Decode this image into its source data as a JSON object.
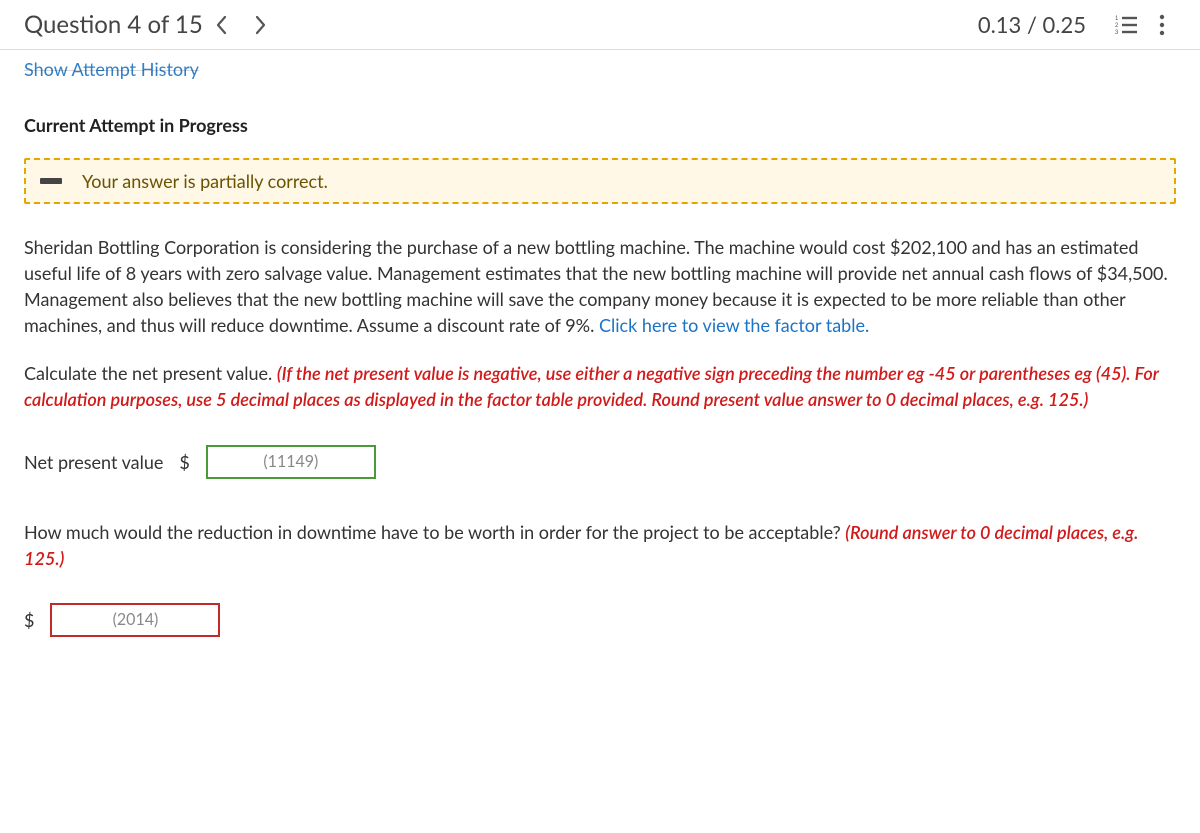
{
  "header": {
    "question_label": "Question 4 of 15",
    "score": "0.13 / 0.25"
  },
  "attempt_history_link": "Show Attempt History",
  "current_attempt_heading": "Current Attempt in Progress",
  "feedback": {
    "text": "Your answer is partially correct."
  },
  "problem": {
    "body_before_link": "Sheridan Bottling Corporation is considering the purchase of a new bottling machine. The machine would cost $202,100 and has an estimated useful life of 8 years with zero salvage value. Management estimates that the new bottling machine will provide net annual cash flows of $34,500. Management also believes that the new bottling machine will save the company money because it is expected to be more reliable than other machines, and thus will reduce downtime. Assume a discount rate of 9%. ",
    "factor_link": "Click here to view the factor table.",
    "calc_prompt": "Calculate the net present value. ",
    "calc_note": "(If the net present value is negative, use either a negative sign preceding the number eg -45 or parentheses eg (45). For calculation purposes, use 5 decimal places as displayed in the factor table provided. Round present value answer to 0 decimal places, e.g. 125.)",
    "npv_label": "Net present value",
    "npv_currency": "$",
    "npv_value": "(11149)",
    "q2_prompt": "How much would the reduction in downtime have to be worth in order for the project to be acceptable? ",
    "q2_note": "(Round answer to 0 decimal places, e.g. 125.)",
    "q2_currency": "$",
    "q2_value": "(2014)"
  }
}
